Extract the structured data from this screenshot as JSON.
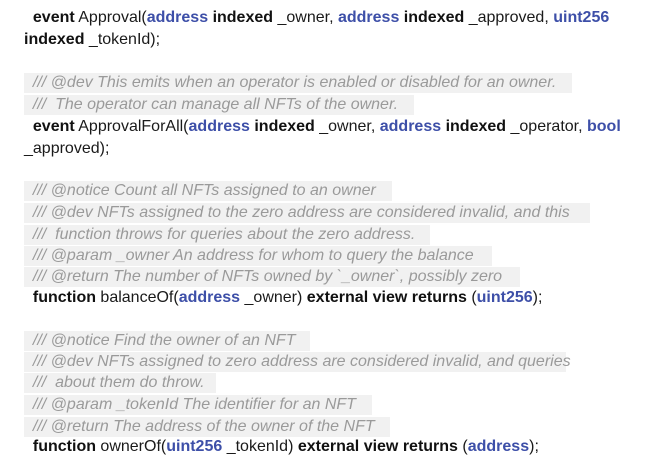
{
  "code_lines": [
    [
      {
        "t": "  ",
        "k": "plain"
      },
      {
        "t": "event",
        "k": "kw"
      },
      {
        "t": " Approval(",
        "k": "plain"
      },
      {
        "t": "address",
        "k": "type"
      },
      {
        "t": " ",
        "k": "plain"
      },
      {
        "t": "indexed",
        "k": "kw"
      },
      {
        "t": " _owner, ",
        "k": "plain"
      },
      {
        "t": "address",
        "k": "type"
      },
      {
        "t": " ",
        "k": "plain"
      },
      {
        "t": "indexed",
        "k": "kw"
      },
      {
        "t": " _approved, ",
        "k": "plain"
      },
      {
        "t": "uint256",
        "k": "type"
      }
    ],
    [
      {
        "t": "indexed",
        "k": "kw"
      },
      {
        "t": " _tokenId);",
        "k": "plain"
      }
    ],
    [],
    [
      {
        "t": "  /// @dev This emits when an operator is enabled or disabled for an owner.",
        "k": "comment"
      }
    ],
    [
      {
        "t": "  ///  The operator can manage all NFTs of the owner.",
        "k": "comment"
      }
    ],
    [
      {
        "t": "  ",
        "k": "plain"
      },
      {
        "t": "event",
        "k": "kw"
      },
      {
        "t": " ApprovalForAll(",
        "k": "plain"
      },
      {
        "t": "address",
        "k": "type"
      },
      {
        "t": " ",
        "k": "plain"
      },
      {
        "t": "indexed",
        "k": "kw"
      },
      {
        "t": " _owner, ",
        "k": "plain"
      },
      {
        "t": "address",
        "k": "type"
      },
      {
        "t": " ",
        "k": "plain"
      },
      {
        "t": "indexed",
        "k": "kw"
      },
      {
        "t": " _operator, ",
        "k": "plain"
      },
      {
        "t": "bool",
        "k": "type"
      }
    ],
    [
      {
        "t": "_approved);",
        "k": "plain"
      }
    ],
    [],
    [
      {
        "t": "  /// @notice Count all NFTs assigned to an owner",
        "k": "comment"
      }
    ],
    [
      {
        "t": "  /// @dev NFTs assigned to the zero address are considered invalid, and this",
        "k": "comment"
      }
    ],
    [
      {
        "t": "  ///  function throws for queries about the zero address.",
        "k": "comment"
      }
    ],
    [
      {
        "t": "  /// @param _owner An address for whom to query the balance",
        "k": "comment"
      }
    ],
    [
      {
        "t": "  /// @return The number of NFTs owned by `_owner`, possibly zero",
        "k": "comment"
      }
    ],
    [
      {
        "t": "  ",
        "k": "plain"
      },
      {
        "t": "function",
        "k": "kw"
      },
      {
        "t": " balanceOf(",
        "k": "plain"
      },
      {
        "t": "address",
        "k": "type"
      },
      {
        "t": " _owner) ",
        "k": "plain"
      },
      {
        "t": "external",
        "k": "kw"
      },
      {
        "t": " ",
        "k": "plain"
      },
      {
        "t": "view",
        "k": "kw"
      },
      {
        "t": " ",
        "k": "plain"
      },
      {
        "t": "returns",
        "k": "kw"
      },
      {
        "t": " (",
        "k": "plain"
      },
      {
        "t": "uint256",
        "k": "type"
      },
      {
        "t": ");",
        "k": "plain"
      }
    ],
    [],
    [
      {
        "t": "  /// @notice Find the owner of an NFT",
        "k": "comment"
      }
    ],
    [
      {
        "t": "  /// @dev NFTs assigned to zero address are considered invalid, and queries",
        "k": "comment"
      }
    ],
    [
      {
        "t": "  ///  about them do throw.",
        "k": "comment"
      }
    ],
    [
      {
        "t": "  /// @param _tokenId The identifier for an NFT",
        "k": "comment"
      }
    ],
    [
      {
        "t": "  /// @return The address of the owner of the NFT",
        "k": "comment"
      }
    ],
    [
      {
        "t": "  ",
        "k": "plain"
      },
      {
        "t": "function",
        "k": "kw"
      },
      {
        "t": " ownerOf(",
        "k": "plain"
      },
      {
        "t": "uint256",
        "k": "type"
      },
      {
        "t": " _tokenId) ",
        "k": "plain"
      },
      {
        "t": "external",
        "k": "kw"
      },
      {
        "t": " ",
        "k": "plain"
      },
      {
        "t": "view",
        "k": "kw"
      },
      {
        "t": " ",
        "k": "plain"
      },
      {
        "t": "returns",
        "k": "kw"
      },
      {
        "t": " (",
        "k": "plain"
      },
      {
        "t": "address",
        "k": "type"
      },
      {
        "t": ");",
        "k": "plain"
      }
    ]
  ]
}
